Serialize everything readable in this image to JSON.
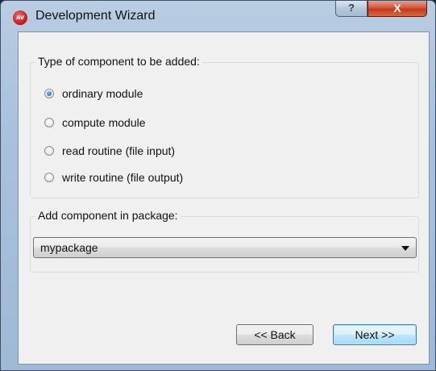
{
  "window": {
    "title": "Development Wizard",
    "app_icon_text": "AV",
    "help_glyph": "?",
    "close_glyph": "X"
  },
  "component_type": {
    "group_title": "Type of component to be added:",
    "options": [
      {
        "label": "ordinary module",
        "selected": true
      },
      {
        "label": "compute module",
        "selected": false
      },
      {
        "label": "read routine (file input)",
        "selected": false
      },
      {
        "label": "write routine (file output)",
        "selected": false
      }
    ]
  },
  "package": {
    "group_title": "Add component in package:",
    "selected_value": "mypackage"
  },
  "buttons": {
    "back_label": "<< Back",
    "next_label": "Next >>"
  }
}
